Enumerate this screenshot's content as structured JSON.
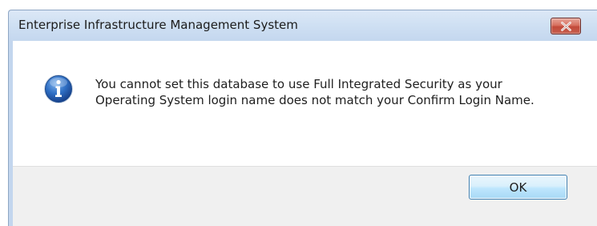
{
  "dialog": {
    "title": "Enterprise Infrastructure Management System",
    "message": "You cannot set this database to use Full Integrated Security as your Operating System login name does not match your Confirm Login Name.",
    "icon": "information-icon",
    "close_icon": "close-icon",
    "ok_label": "OK"
  },
  "colors": {
    "close_button": "#c65f4e",
    "title_bar": "#cfe0f3",
    "ok_border": "#3c7fb1",
    "footer": "#f0f0f0"
  }
}
